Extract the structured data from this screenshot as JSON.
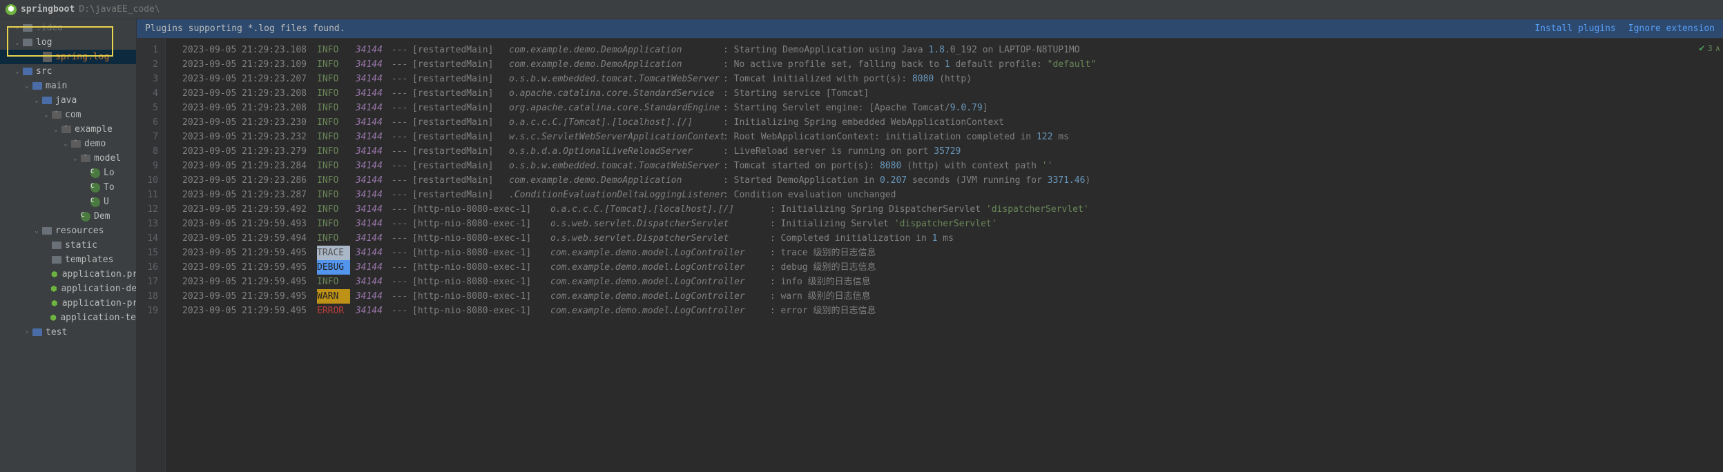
{
  "header": {
    "project_name": "springboot",
    "project_path": "D:\\javaEE_code\\"
  },
  "notice": {
    "text": "Plugins supporting *.log files found.",
    "install": "Install plugins",
    "ignore": "Ignore extension"
  },
  "tree": [
    {
      "indent": 1,
      "arrow": "›",
      "icon": "folder-dim",
      "label": ".idea",
      "dim": true
    },
    {
      "indent": 1,
      "arrow": "⌄",
      "icon": "folder",
      "label": "log"
    },
    {
      "indent": 3,
      "arrow": "",
      "icon": "file-log",
      "label": "spring.log",
      "selected": true,
      "logcolor": true
    },
    {
      "indent": 1,
      "arrow": "⌄",
      "icon": "folder-src",
      "label": "src"
    },
    {
      "indent": 2,
      "arrow": "⌄",
      "icon": "folder-src",
      "label": "main"
    },
    {
      "indent": 3,
      "arrow": "⌄",
      "icon": "folder-src",
      "label": "java"
    },
    {
      "indent": 4,
      "arrow": "⌄",
      "icon": "pkg",
      "label": "com"
    },
    {
      "indent": 5,
      "arrow": "⌄",
      "icon": "pkg",
      "label": "example"
    },
    {
      "indent": 6,
      "arrow": "⌄",
      "icon": "pkg",
      "label": "demo"
    },
    {
      "indent": 7,
      "arrow": "⌄",
      "icon": "pkg",
      "label": "model"
    },
    {
      "indent": 8,
      "arrow": "",
      "icon": "class",
      "label": "Lo"
    },
    {
      "indent": 8,
      "arrow": "",
      "icon": "class",
      "label": "To"
    },
    {
      "indent": 8,
      "arrow": "",
      "icon": "class",
      "label": "U"
    },
    {
      "indent": 7,
      "arrow": "",
      "icon": "class",
      "label": "Dem",
      "sb": true
    },
    {
      "indent": 3,
      "arrow": "⌄",
      "icon": "folder",
      "label": "resources",
      "res": true
    },
    {
      "indent": 4,
      "arrow": "",
      "icon": "folder",
      "label": "static"
    },
    {
      "indent": 4,
      "arrow": "",
      "icon": "folder",
      "label": "templates"
    },
    {
      "indent": 4,
      "arrow": "",
      "icon": "prop",
      "label": "application.prop",
      "sb": true
    },
    {
      "indent": 4,
      "arrow": "",
      "icon": "prop",
      "label": "application-dev.p",
      "sb": true
    },
    {
      "indent": 4,
      "arrow": "",
      "icon": "prop",
      "label": "application-prod",
      "sb": true
    },
    {
      "indent": 4,
      "arrow": "",
      "icon": "prop",
      "label": "application-test.p",
      "sb": true
    },
    {
      "indent": 2,
      "arrow": "›",
      "icon": "folder-src",
      "label": "test"
    }
  ],
  "gutter": [
    "1",
    "2",
    "3",
    "4",
    "5",
    "6",
    "7",
    "8",
    "9",
    "10",
    "11",
    "12",
    "13",
    "14",
    "15",
    "16",
    "17",
    "18",
    "19"
  ],
  "right_marks": {
    "count": "3",
    "up": "∧"
  },
  "logs": [
    {
      "ts": "2023-09-05 21:29:23.108",
      "lvl": "INFO",
      "pid": "34144",
      "thread": "[restartedMain]",
      "logger": "com.example.demo.DemoApplication",
      "lw": 310,
      "msg": ": Starting DemoApplication using Java <n>1.8</n>.0_192 on LAPTOP-N8TUP1MO"
    },
    {
      "ts": "2023-09-05 21:29:23.109",
      "lvl": "INFO",
      "pid": "34144",
      "thread": "[restartedMain]",
      "logger": "com.example.demo.DemoApplication",
      "lw": 310,
      "msg": ": No active profile set, falling back to <n>1</n> default profile: <s>\"default\"</s>"
    },
    {
      "ts": "2023-09-05 21:29:23.207",
      "lvl": "INFO",
      "pid": "34144",
      "thread": "[restartedMain]",
      "logger": "o.s.b.w.embedded.tomcat.TomcatWebServer",
      "lw": 310,
      "msg": ": Tomcat initialized with port(s): <n>8080</n> (http)"
    },
    {
      "ts": "2023-09-05 21:29:23.208",
      "lvl": "INFO",
      "pid": "34144",
      "thread": "[restartedMain]",
      "logger": "o.apache.catalina.core.StandardService",
      "lw": 310,
      "msg": ": Starting service [Tomcat]"
    },
    {
      "ts": "2023-09-05 21:29:23.208",
      "lvl": "INFO",
      "pid": "34144",
      "thread": "[restartedMain]",
      "logger": "org.apache.catalina.core.StandardEngine",
      "lw": 310,
      "msg": ": Starting Servlet engine: [Apache Tomcat/<n>9.0.79</n>]"
    },
    {
      "ts": "2023-09-05 21:29:23.230",
      "lvl": "INFO",
      "pid": "34144",
      "thread": "[restartedMain]",
      "logger": "o.a.c.c.C.[Tomcat].[localhost].[/]",
      "lw": 310,
      "msg": ": Initializing Spring embedded WebApplicationContext"
    },
    {
      "ts": "2023-09-05 21:29:23.232",
      "lvl": "INFO",
      "pid": "34144",
      "thread": "[restartedMain]",
      "logger": "w.s.c.ServletWebServerApplicationContext",
      "lw": 310,
      "msg": ": Root WebApplicationContext: initialization completed in <n>122</n> ms"
    },
    {
      "ts": "2023-09-05 21:29:23.279",
      "lvl": "INFO",
      "pid": "34144",
      "thread": "[restartedMain]",
      "logger": "o.s.b.d.a.OptionalLiveReloadServer",
      "lw": 310,
      "msg": ": LiveReload server is running on port <n>35729</n>"
    },
    {
      "ts": "2023-09-05 21:29:23.284",
      "lvl": "INFO",
      "pid": "34144",
      "thread": "[restartedMain]",
      "logger": "o.s.b.w.embedded.tomcat.TomcatWebServer",
      "lw": 310,
      "msg": ": Tomcat started on port(s): <n>8080</n> (http) with context path <s>''</s>"
    },
    {
      "ts": "2023-09-05 21:29:23.286",
      "lvl": "INFO",
      "pid": "34144",
      "thread": "[restartedMain]",
      "logger": "com.example.demo.DemoApplication",
      "lw": 310,
      "msg": ": Started DemoApplication in <n>0.207</n> seconds (JVM running for <n>3371.46</n>)"
    },
    {
      "ts": "2023-09-05 21:29:23.287",
      "lvl": "INFO",
      "pid": "34144",
      "thread": "[restartedMain]",
      "logger": ".ConditionEvaluationDeltaLoggingListener",
      "lw": 310,
      "msg": ": Condition evaluation unchanged"
    },
    {
      "ts": "2023-09-05 21:29:59.492",
      "lvl": "INFO",
      "pid": "34144",
      "thread": "[http-nio-<n>8080</n>-exec-<n>1</n>]",
      "logger": "o.a.c.c.C.[Tomcat].[localhost].[/]",
      "lw": 310,
      "msg": " : Initializing Spring DispatcherServlet <s>'dispatcherServlet'</s>",
      "line12": true
    },
    {
      "ts": "2023-09-05 21:29:59.493",
      "lvl": "INFO",
      "pid": "34144",
      "thread": "[http-nio-<n>8080</n>-exec-<n>1</n>]",
      "logger": "o.s.web.servlet.DispatcherServlet",
      "lw": 310,
      "msg": " : Initializing Servlet <s>'dispatcherServlet'</s>"
    },
    {
      "ts": "2023-09-05 21:29:59.494",
      "lvl": "INFO",
      "pid": "34144",
      "thread": "[http-nio-<n>8080</n>-exec-<n>1</n>]",
      "logger": "o.s.web.servlet.DispatcherServlet",
      "lw": 310,
      "msg": " : Completed initialization in <n>1</n> ms"
    },
    {
      "ts": "2023-09-05 21:29:59.495",
      "lvl": "TRACE",
      "pid": "34144",
      "thread": "[http-nio-<n>8080</n>-exec-<n>1</n>]",
      "logger": "com.example.demo.model.LogController",
      "lw": 310,
      "msg": " : trace 级别的日志信息"
    },
    {
      "ts": "2023-09-05 21:29:59.495",
      "lvl": "DEBUG",
      "pid": "34144",
      "thread": "[http-nio-<n>8080</n>-exec-<n>1</n>]",
      "logger": "com.example.demo.model.LogController",
      "lw": 310,
      "msg": " : debug 级别的日志信息"
    },
    {
      "ts": "2023-09-05 21:29:59.495",
      "lvl": "INFO",
      "pid": "34144",
      "thread": "[http-nio-<n>8080</n>-exec-<n>1</n>]",
      "logger": "com.example.demo.model.LogController",
      "lw": 310,
      "msg": " : info 级别的日志信息"
    },
    {
      "ts": "2023-09-05 21:29:59.495",
      "lvl": "WARN",
      "pid": "34144",
      "thread": "[http-nio-<n>8080</n>-exec-<n>1</n>]",
      "logger": "com.example.demo.model.LogController",
      "lw": 310,
      "msg": " : warn 级别的日志信息"
    },
    {
      "ts": "2023-09-05 21:29:59.495",
      "lvl": "ERROR",
      "pid": "34144",
      "thread": "[http-nio-<n>8080</n>-exec-<n>1</n>]",
      "logger": "com.example.demo.model.LogController",
      "lw": 310,
      "msg": " : error 级别的日志信息"
    }
  ]
}
